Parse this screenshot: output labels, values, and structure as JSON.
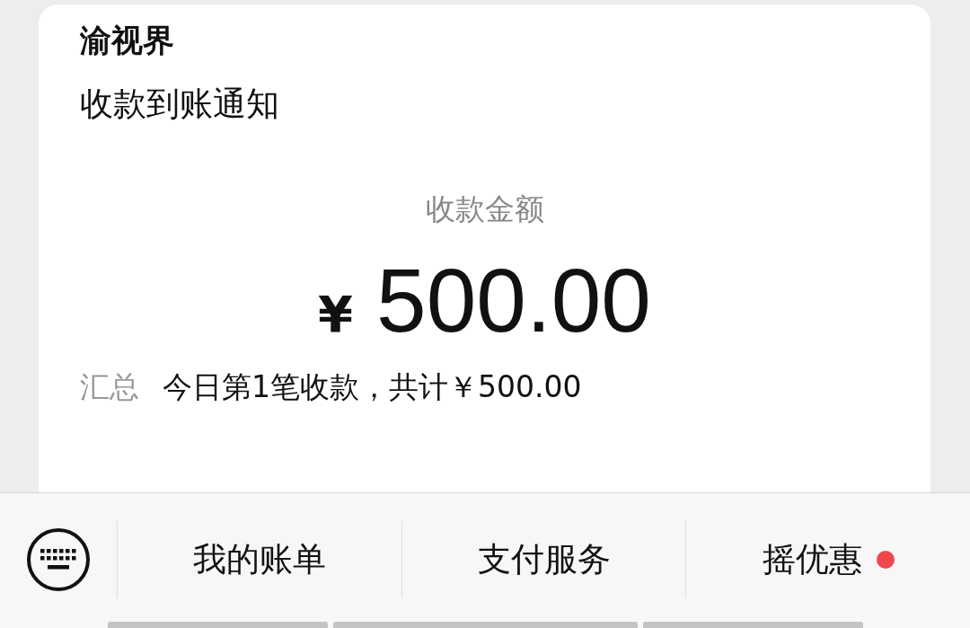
{
  "message": {
    "sender": "渝视界",
    "title": "收款到账通知",
    "amount_label": "收款金额",
    "currency": "¥",
    "amount": "500.00",
    "summary_label": "汇总",
    "summary_text": "今日第1笔收款，共计￥500.00"
  },
  "menu_bar": {
    "items": [
      {
        "label": "我的账单",
        "dot": false
      },
      {
        "label": "支付服务",
        "dot": false
      },
      {
        "label": "摇优惠",
        "dot": true
      }
    ]
  }
}
